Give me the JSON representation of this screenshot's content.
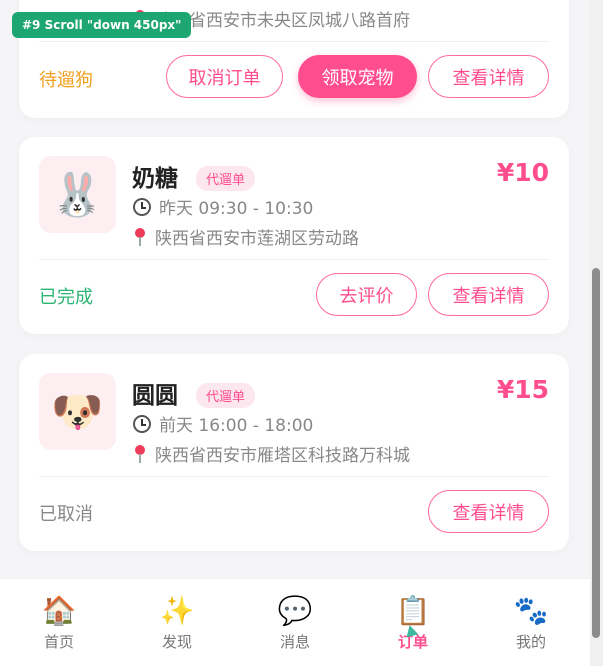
{
  "scroll_badge": "#9 Scroll \"down 450px\"",
  "orders": [
    {
      "address": "陕西省西安市未央区凤城八路首府",
      "status": "待遛狗",
      "status_color": "#f0a020",
      "buttons": [
        "取消订单",
        "领取宠物",
        "查看详情"
      ]
    },
    {
      "name": "奶糖",
      "tag": "代遛单",
      "price": "¥10",
      "time": "昨天 09:30 - 10:30",
      "address": "陕西省西安市莲湖区劳动路",
      "status": "已完成",
      "status_color": "#2bb673",
      "avatar_icon": "rabbit-icon",
      "buttons": [
        "去评价",
        "查看详情"
      ]
    },
    {
      "name": "圆圆",
      "tag": "代遛单",
      "price": "¥15",
      "time": "前天 16:00 - 18:00",
      "address": "陕西省西安市雁塔区科技路万科城",
      "status": "已取消",
      "status_color": "#888888",
      "avatar_icon": "dog-icon",
      "buttons": [
        "查看详情"
      ]
    }
  ],
  "tabbar": {
    "items": [
      {
        "label": "首页",
        "icon": "home-icon"
      },
      {
        "label": "发现",
        "icon": "sparkles-icon"
      },
      {
        "label": "消息",
        "icon": "speech-bubble-icon"
      },
      {
        "label": "订单",
        "icon": "clipboard-icon",
        "active": true
      },
      {
        "label": "我的",
        "icon": "paw-icon"
      }
    ]
  },
  "colors": {
    "accent": "#ff4d8d",
    "background": "#f5f5f7"
  }
}
